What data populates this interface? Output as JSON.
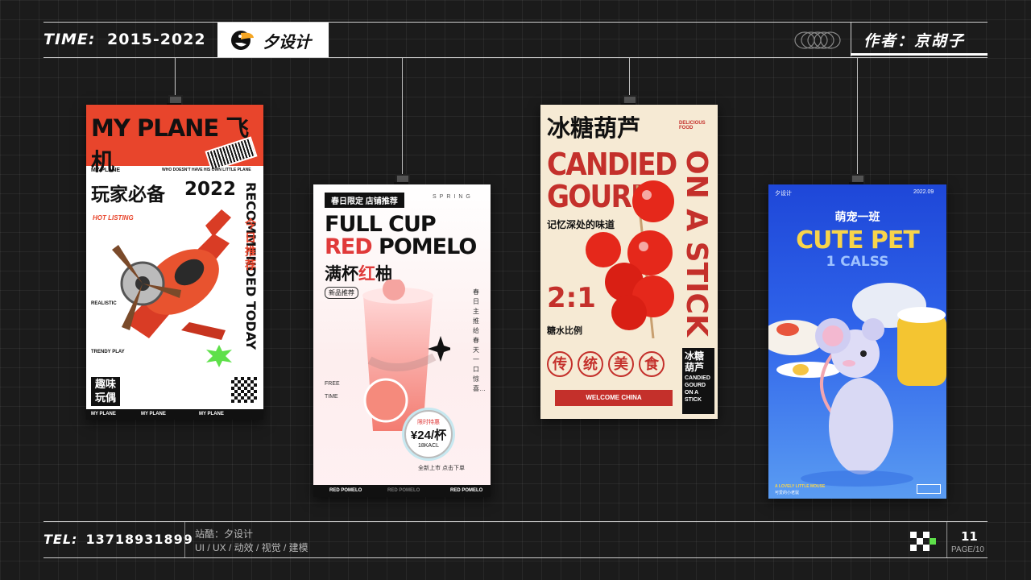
{
  "header": {
    "time_label": "TIME:",
    "time_value": "2015-2022",
    "logo_text": "夕设计",
    "author": "作者：京胡子"
  },
  "footer": {
    "tel_label": "TEL:",
    "tel_value": "13718931899",
    "site_line1": "站酷：夕设计",
    "site_line2": "UI / UX / 动效 / 视觉 / 建模",
    "page_number": "11",
    "page_total": "PAGE/10"
  },
  "posters": [
    {
      "headline": "MY PLANE 飞机",
      "strip_left": "MY PLANE",
      "strip_right": "WHO DOESN'T HAVE HIS OWN LITTLE PLANE",
      "cn_title": "玩家必备",
      "year": "2022",
      "hot": "HOT LISTING",
      "vertical_en": "RECOMMENDED TODAY",
      "vertical_cn": "今日推荐",
      "labels": [
        "REALISTIC",
        "TRENDY PLAY"
      ],
      "fun": "趣味玩偶",
      "foot": [
        "MY PLANE",
        "MY PLANE",
        "MY PLANE"
      ]
    },
    {
      "tag": "春日限定 店铺推荐",
      "spring": "SPRING",
      "line1": "FULL CUP",
      "line2_red": "RED",
      "line2_black": " POMELO",
      "cn_black1": "满杯",
      "cn_red": "红",
      "cn_black2": "柚",
      "new_label": "新品推荐",
      "vertical_side": "春日主推 给春天一口惊喜…",
      "vertical_free": "FREE TIME",
      "price_label": "限时特惠",
      "price": "¥24/杯",
      "price_kcal": "18KACL",
      "bottom": "全新上市 点击下单",
      "foot": [
        "RED POMELO",
        "RED POMELO",
        "RED POMELO"
      ]
    },
    {
      "title": "冰糖葫芦",
      "delicious": "DELICIOUS FOOD",
      "big1": "CANDIED",
      "big2": "GOURD",
      "vertical": "ON A STICK",
      "memory": "记忆深处的味道",
      "ratio": "2:1",
      "ratio_cn": "糖水比例",
      "trad": [
        "传",
        "统",
        "美",
        "食"
      ],
      "box_cn": "冰糖葫芦",
      "box_en": "CANDIED GOURD ON A STICK",
      "ribbon": "WELCOME CHINA"
    },
    {
      "brand": "夕设计",
      "date": "2022.09",
      "cn": "萌宠一班",
      "en": "CUTE PET",
      "en2": "1 CALSS",
      "bottom1": "A LOVELY LITTLE MOUSE",
      "bottom2": "可爱的小老鼠"
    }
  ]
}
